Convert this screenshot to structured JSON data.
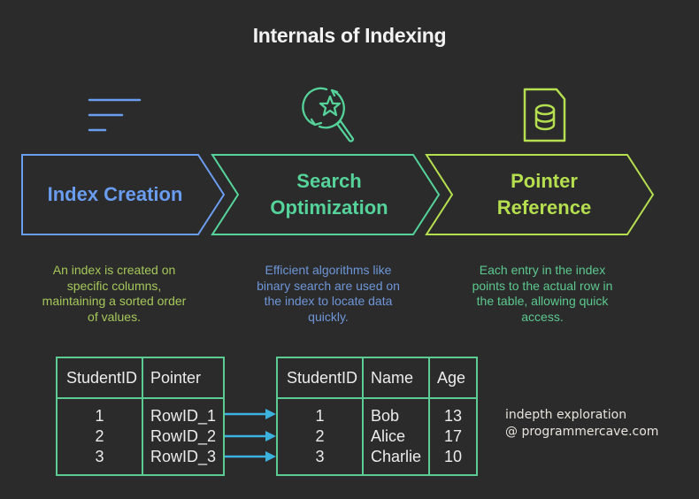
{
  "title": "Internals of Indexing",
  "stages": [
    {
      "label_line1": "Index Creation",
      "label_line2": "",
      "icon": "filter-lines-icon",
      "color": "#6a9df0",
      "description": [
        "An index is created on",
        "specific columns,",
        "maintaining a sorted order",
        "of values."
      ],
      "description_color": "#a6c85a"
    },
    {
      "label_line1": "Search",
      "label_line2": "Optimization",
      "icon": "search-star-icon",
      "color": "#55d39a",
      "description": [
        "Efficient algorithms like",
        "binary search are used on",
        "the index to locate data",
        "quickly."
      ],
      "description_color": "#6e96d8"
    },
    {
      "label_line1": "Pointer",
      "label_line2": "Reference",
      "icon": "database-file-icon",
      "color": "#b5df4f",
      "description": [
        "Each entry in the index",
        "points to the actual row in",
        "the table, allowing quick",
        "access."
      ],
      "description_color": "#5cc98f"
    }
  ],
  "index_table": {
    "headers": [
      "StudentID",
      "Pointer"
    ],
    "rows": [
      [
        "1",
        "RowID_1"
      ],
      [
        "2",
        "RowID_2"
      ],
      [
        "3",
        "RowID_3"
      ]
    ]
  },
  "data_table": {
    "headers": [
      "StudentID",
      "Name",
      "Age"
    ],
    "rows": [
      [
        "1",
        "Bob",
        "13"
      ],
      [
        "2",
        "Alice",
        "17"
      ],
      [
        "3",
        "Charlie",
        "10"
      ]
    ]
  },
  "arrow_color": "#3bb3de",
  "table_border_color": "#5ccb93",
  "credit": {
    "line1": "indepth exploration",
    "line2": "@ programmercave.com"
  }
}
